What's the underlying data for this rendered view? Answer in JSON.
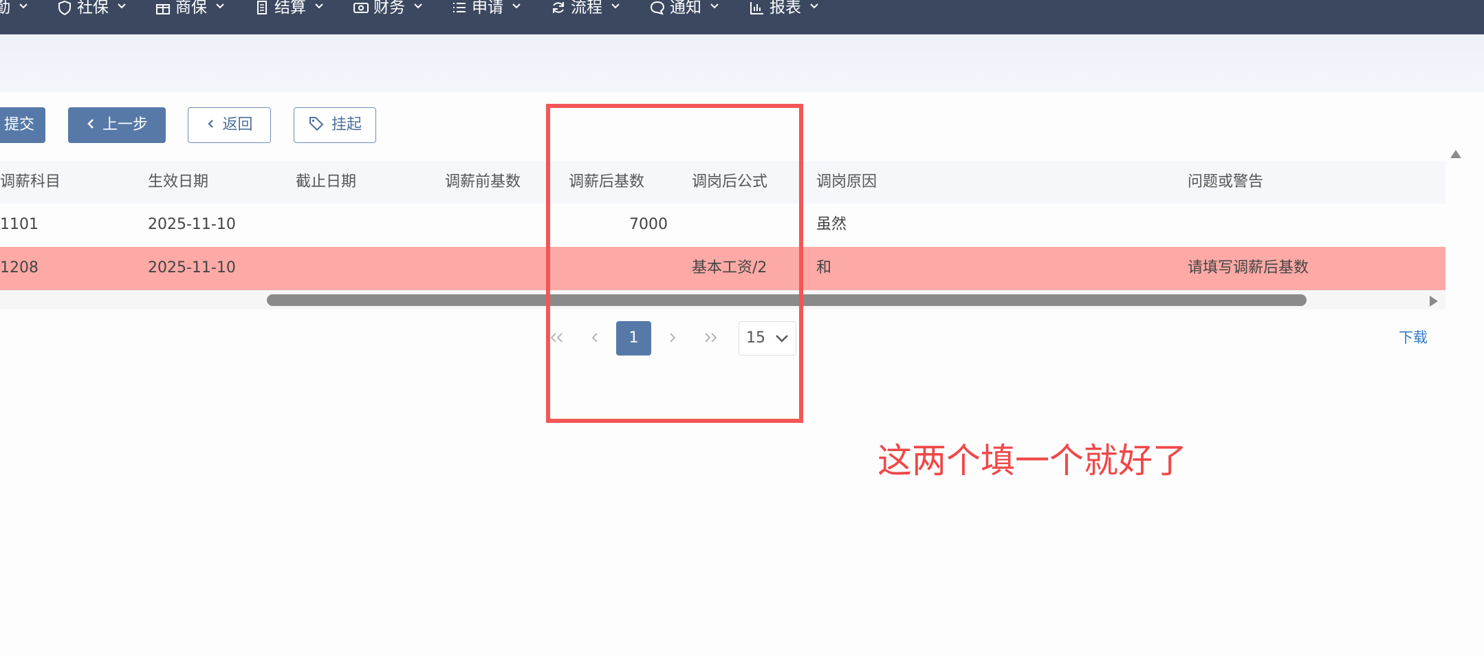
{
  "nav": {
    "items": [
      {
        "label": "勤",
        "icon": "partial-icon"
      },
      {
        "label": "社保",
        "icon": "shield-icon"
      },
      {
        "label": "商保",
        "icon": "gift-icon"
      },
      {
        "label": "结算",
        "icon": "document-icon"
      },
      {
        "label": "财务",
        "icon": "money-icon"
      },
      {
        "label": "申请",
        "icon": "list-icon"
      },
      {
        "label": "流程",
        "icon": "refresh-icon"
      },
      {
        "label": "通知",
        "icon": "chat-icon"
      },
      {
        "label": "报表",
        "icon": "bar-chart-icon"
      }
    ]
  },
  "toolbar": {
    "submit_label": "提交",
    "prev_label": "上一步",
    "back_label": "返回",
    "suspend_label": "挂起"
  },
  "table": {
    "columns": [
      "调薪科目",
      "生效日期",
      "截止日期",
      "调薪前基数",
      "调薪后基数",
      "调岗后公式",
      "调岗原因",
      "问题或警告"
    ],
    "rows": [
      {
        "subject": "1101",
        "effective_date": "2025-11-10",
        "end_date": "",
        "base_before": "",
        "base_after": "7000",
        "formula": "",
        "reason": "虽然",
        "warning": "",
        "status": "normal"
      },
      {
        "subject": "1208",
        "effective_date": "2025-11-10",
        "end_date": "",
        "base_before": "",
        "base_after": "",
        "formula": "基本工资/2",
        "reason": "和",
        "warning": "请填写调薪后基数",
        "status": "error"
      }
    ],
    "error_row_color": "#fdaaa6"
  },
  "pagination": {
    "current_page": "1",
    "page_size": "15",
    "download_label": "下载"
  },
  "annotation": {
    "text": "这两个填一个就好了",
    "color": "#ef4848"
  },
  "colors": {
    "nav_bg": "#3b4860",
    "primary": "#5679a8",
    "link": "#2f79c6"
  }
}
